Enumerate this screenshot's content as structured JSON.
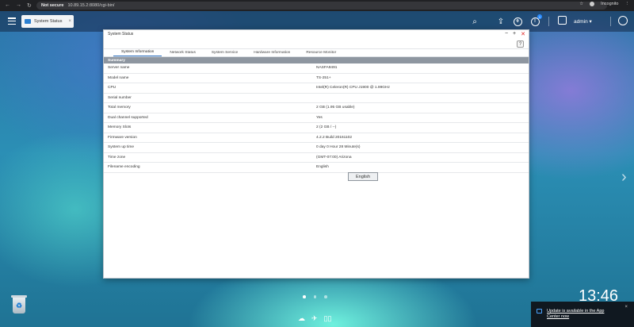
{
  "browser": {
    "security_label": "Not secure",
    "url": "10.89.15.2:8080/cgi-bin/",
    "profile_label": "Incognito"
  },
  "topbar": {
    "tab_label": "System Status",
    "tab_close": "×",
    "notification_count": "1",
    "user_label": "admin ▾"
  },
  "window": {
    "title": "System Status",
    "minimize": "−",
    "maximize": "+",
    "close": "✕",
    "help": "?",
    "tabs": [
      "System Information",
      "Network Status",
      "System Service",
      "Hardware Information",
      "Resource Monitor"
    ],
    "section": "Summary",
    "rows": [
      {
        "label": "Server name",
        "value": "NASFA9491"
      },
      {
        "label": "Model name",
        "value": "TS-251+"
      },
      {
        "label": "CPU",
        "value": "Intel(R) Celeron(R) CPU J1900 @ 1.99GHz"
      },
      {
        "label": "Serial number",
        "value": ""
      },
      {
        "label": "Total memory",
        "value": "2 GB (1.95 GB usable)"
      },
      {
        "label": "Dual channel supported",
        "value": "Yes"
      },
      {
        "label": "Memory Slots",
        "value": "2 (2 GB / --)"
      },
      {
        "label": "Firmware version",
        "value": "4.2.2 Build 20161102"
      },
      {
        "label": "System up time",
        "value": "0 day 0 Hour 28 Minute(s)"
      },
      {
        "label": "Time zone",
        "value": "(GMT-07:00) Arizona"
      },
      {
        "label": "Filename encoding",
        "value": "English"
      }
    ],
    "tooltip": "English"
  },
  "desktop": {
    "clock": "13:46",
    "notification": "Update is available in the App Center now",
    "notification_close": "×"
  }
}
